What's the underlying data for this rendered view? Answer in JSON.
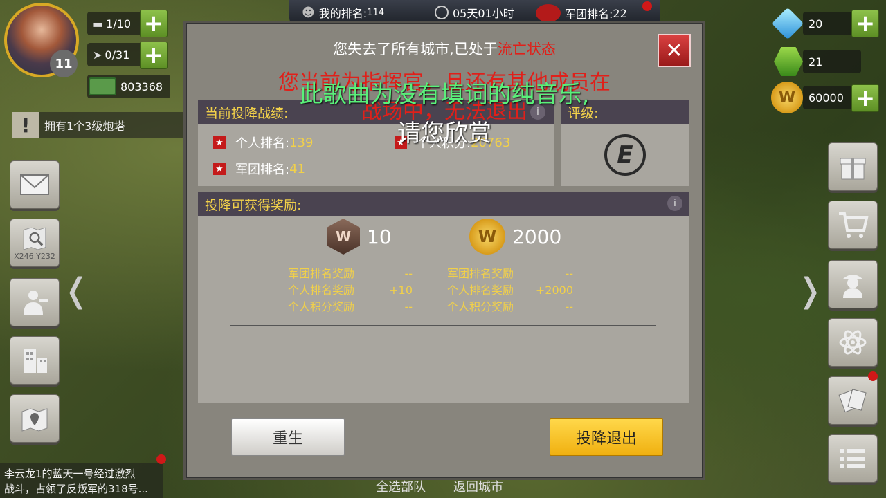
{
  "top_bar": {
    "my_rank": "我的排名:",
    "my_rank_value": "114",
    "timer": "05天01小时",
    "legion_rank": "军团排名:",
    "legion_rank_value": "22"
  },
  "player": {
    "level": "11",
    "tanks": "1/10",
    "planes": "0/31",
    "money": "803368"
  },
  "resources": {
    "diamonds": "20",
    "oil": "21",
    "gold": "60000"
  },
  "notice": {
    "text": "拥有1个3级炮塔"
  },
  "coords": "X246 Y232",
  "chat": {
    "line1": "李云龙1的蓝天一号经过激烈",
    "line2": "战斗，占领了反叛军的318号..."
  },
  "bottom_links": {
    "select_all": "全选部队",
    "return_city": "返回城市"
  },
  "dialog": {
    "title_prefix": "您失去了所有城市,已处于",
    "title_status": "流亡状态",
    "warning_line1": "您当前为指挥官，且还有其他成员在",
    "warning_line2": "战场中，无法退出",
    "overlay_line1": "此歌曲为没有填词的纯音乐,",
    "overlay_line2": "请您欣赏",
    "record_header": "当前投降战绩:",
    "rating_header": "评级:",
    "rating_value": "E",
    "personal_rank_label": "个人排名:",
    "personal_rank_value": "139",
    "personal_points_label": "个人积分:",
    "personal_points_value": "20763",
    "legion_rank_label": "军团排名:",
    "legion_rank_value": "41",
    "reward_header": "投降可获得奖励:",
    "reward_badge_value": "10",
    "reward_gold_value": "2000",
    "left_rewards": [
      {
        "label": "军团排名奖励",
        "value": "--"
      },
      {
        "label": "个人排名奖励",
        "value": "+10"
      },
      {
        "label": "个人积分奖励",
        "value": "--"
      }
    ],
    "right_rewards": [
      {
        "label": "军团排名奖励",
        "value": "--"
      },
      {
        "label": "个人排名奖励",
        "value": "+2000"
      },
      {
        "label": "个人积分奖励",
        "value": "--"
      }
    ],
    "respawn_button": "重生",
    "surrender_button": "投降退出"
  },
  "colors": {
    "accent_yellow": "#f1d04a",
    "status_red": "#e0201a",
    "overlay_green": "#5af07a",
    "plus_green": "#6fa633"
  }
}
